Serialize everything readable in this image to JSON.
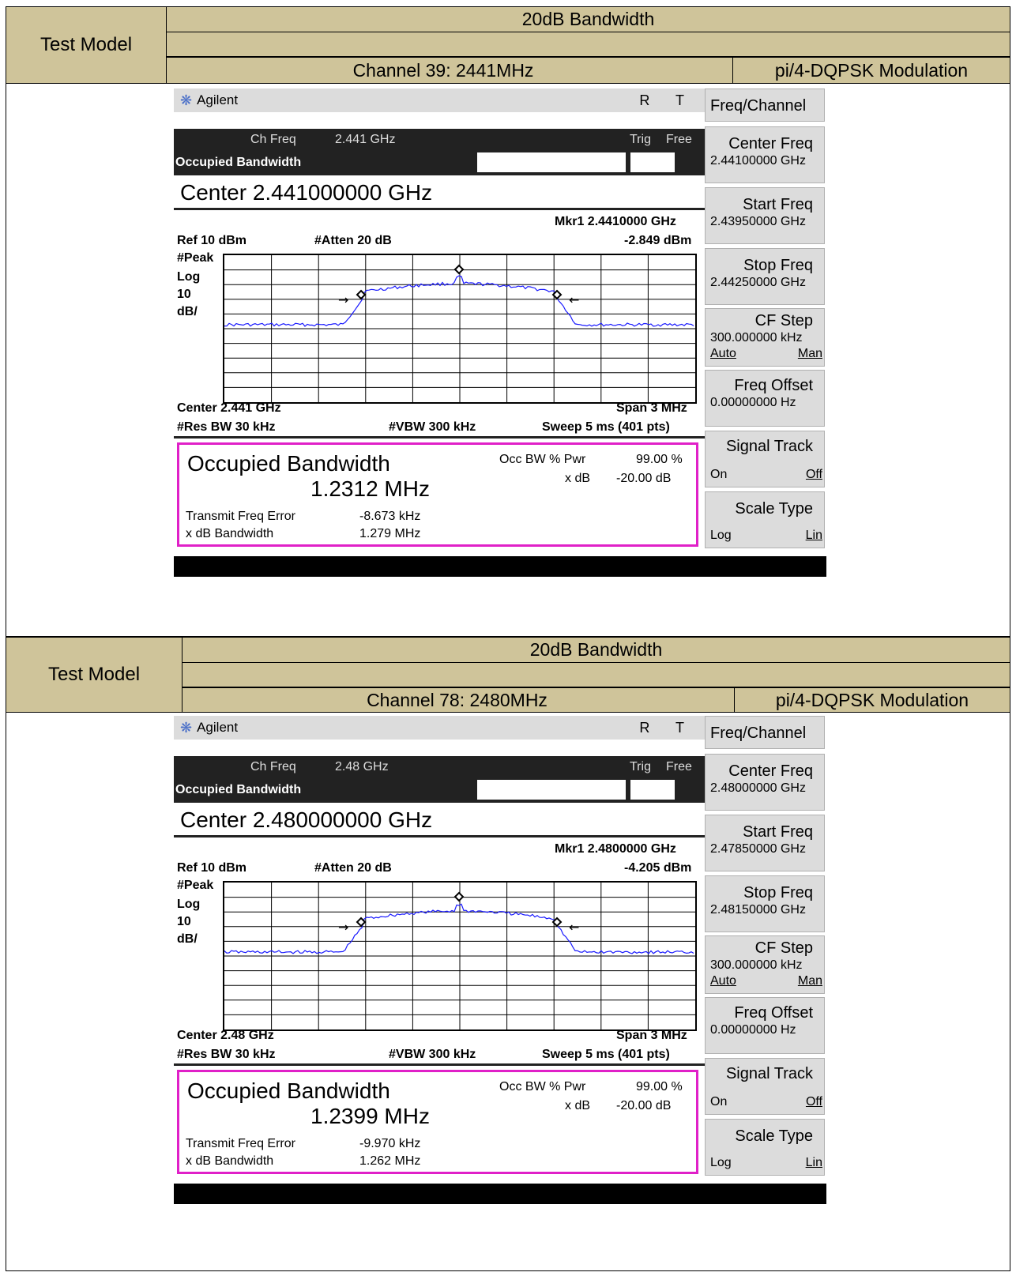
{
  "sections": [
    {
      "row_label": "Test Model",
      "title": "20dB Bandwidth",
      "channel": "Channel 39: 2441MHz",
      "modulation": "pi/4-DQPSK Modulation",
      "analyzer": {
        "brand": "Agilent",
        "rt": "R T",
        "ch_freq_label": "Ch Freq",
        "ch_freq_value": "2.441 GHz",
        "trig_label": "Trig",
        "trig_value": "Free",
        "mode_label": "Occupied Bandwidth",
        "center_text": "Center 2.441000000 GHz",
        "marker": "Mkr1  2.4410000 GHz",
        "marker_level": "-2.849 dBm",
        "ref": "Ref 10 dBm",
        "atten": "#Atten 20 dB",
        "peak": "#Peak",
        "log": "Log",
        "scale_num": "10",
        "scale_unit": "dB/",
        "center_freq_label": "Center 2.441 GHz",
        "span": "Span 3 MHz",
        "res_bw": "#Res BW 30 kHz",
        "vbw": "#VBW 300 kHz",
        "sweep": "Sweep 5 ms (401 pts)",
        "occ_title": "Occupied Bandwidth",
        "occ_value": "1.2312 MHz",
        "occ_pwr_label": "Occ BW % Pwr",
        "occ_pwr_value": "99.00 %",
        "xdb_label": "x dB",
        "xdb_value": "-20.00 dB",
        "tfe_label": "Transmit Freq Error",
        "tfe_value": "-8.673 kHz",
        "xdb_bw_label": "x dB Bandwidth",
        "xdb_bw_value": "1.279 MHz",
        "softkeys": {
          "menu": "Freq/Channel",
          "center_freq": "Center Freq",
          "center_freq_value": "2.44100000 GHz",
          "start_freq": "Start Freq",
          "start_freq_value": "2.43950000 GHz",
          "stop_freq": "Stop Freq",
          "stop_freq_value": "2.44250000 GHz",
          "cf_step": "CF Step",
          "cf_step_value": "300.000000 kHz",
          "auto": "Auto",
          "man": "Man",
          "freq_offset": "Freq Offset",
          "freq_offset_value": "0.00000000  Hz",
          "signal_track": "Signal Track",
          "on": "On",
          "off": "Off",
          "scale_type": "Scale Type",
          "log": "Log",
          "lin": "Lin"
        }
      }
    },
    {
      "row_label": "Test Model",
      "title": "20dB Bandwidth",
      "channel": "Channel 78: 2480MHz",
      "modulation": "pi/4-DQPSK Modulation",
      "analyzer": {
        "brand": "Agilent",
        "rt": "R T",
        "ch_freq_label": "Ch Freq",
        "ch_freq_value": "2.48 GHz",
        "trig_label": "Trig",
        "trig_value": "Free",
        "mode_label": "Occupied Bandwidth",
        "center_text": "Center 2.480000000 GHz",
        "marker": "Mkr1  2.4800000 GHz",
        "marker_level": "-4.205 dBm",
        "ref": "Ref 10 dBm",
        "atten": "#Atten 20 dB",
        "peak": "#Peak",
        "log": "Log",
        "scale_num": "10",
        "scale_unit": "dB/",
        "center_freq_label": "Center 2.48 GHz",
        "span": "Span 3 MHz",
        "res_bw": "#Res BW 30 kHz",
        "vbw": "#VBW 300 kHz",
        "sweep": "Sweep 5 ms (401 pts)",
        "occ_title": "Occupied Bandwidth",
        "occ_value": "1.2399 MHz",
        "occ_pwr_label": "Occ BW % Pwr",
        "occ_pwr_value": "99.00 %",
        "xdb_label": "x dB",
        "xdb_value": "-20.00 dB",
        "tfe_label": "Transmit Freq Error",
        "tfe_value": "-9.970 kHz",
        "xdb_bw_label": "x dB Bandwidth",
        "xdb_bw_value": "1.262 MHz",
        "softkeys": {
          "menu": "Freq/Channel",
          "center_freq": "Center Freq",
          "center_freq_value": "2.48000000 GHz",
          "start_freq": "Start Freq",
          "start_freq_value": "2.47850000 GHz",
          "stop_freq": "Stop Freq",
          "stop_freq_value": "2.48150000 GHz",
          "cf_step": "CF Step",
          "cf_step_value": "300.000000 kHz",
          "auto": "Auto",
          "man": "Man",
          "freq_offset": "Freq Offset",
          "freq_offset_value": "0.00000000  Hz",
          "signal_track": "Signal Track",
          "on": "On",
          "off": "Off",
          "scale_type": "Scale Type",
          "log": "Log",
          "lin": "Lin"
        }
      }
    }
  ],
  "colors": {
    "header_bg": "#cfc49a",
    "trace": "#1a1aff",
    "occ_box_border": "#e020c8"
  }
}
